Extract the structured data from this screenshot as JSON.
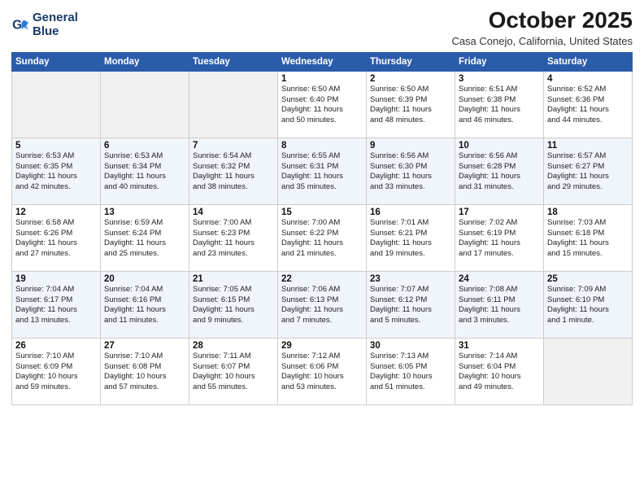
{
  "header": {
    "logo_line1": "General",
    "logo_line2": "Blue",
    "month": "October 2025",
    "location": "Casa Conejo, California, United States"
  },
  "weekdays": [
    "Sunday",
    "Monday",
    "Tuesday",
    "Wednesday",
    "Thursday",
    "Friday",
    "Saturday"
  ],
  "weeks": [
    [
      {
        "day": "",
        "info": ""
      },
      {
        "day": "",
        "info": ""
      },
      {
        "day": "",
        "info": ""
      },
      {
        "day": "1",
        "info": "Sunrise: 6:50 AM\nSunset: 6:40 PM\nDaylight: 11 hours\nand 50 minutes."
      },
      {
        "day": "2",
        "info": "Sunrise: 6:50 AM\nSunset: 6:39 PM\nDaylight: 11 hours\nand 48 minutes."
      },
      {
        "day": "3",
        "info": "Sunrise: 6:51 AM\nSunset: 6:38 PM\nDaylight: 11 hours\nand 46 minutes."
      },
      {
        "day": "4",
        "info": "Sunrise: 6:52 AM\nSunset: 6:36 PM\nDaylight: 11 hours\nand 44 minutes."
      }
    ],
    [
      {
        "day": "5",
        "info": "Sunrise: 6:53 AM\nSunset: 6:35 PM\nDaylight: 11 hours\nand 42 minutes."
      },
      {
        "day": "6",
        "info": "Sunrise: 6:53 AM\nSunset: 6:34 PM\nDaylight: 11 hours\nand 40 minutes."
      },
      {
        "day": "7",
        "info": "Sunrise: 6:54 AM\nSunset: 6:32 PM\nDaylight: 11 hours\nand 38 minutes."
      },
      {
        "day": "8",
        "info": "Sunrise: 6:55 AM\nSunset: 6:31 PM\nDaylight: 11 hours\nand 35 minutes."
      },
      {
        "day": "9",
        "info": "Sunrise: 6:56 AM\nSunset: 6:30 PM\nDaylight: 11 hours\nand 33 minutes."
      },
      {
        "day": "10",
        "info": "Sunrise: 6:56 AM\nSunset: 6:28 PM\nDaylight: 11 hours\nand 31 minutes."
      },
      {
        "day": "11",
        "info": "Sunrise: 6:57 AM\nSunset: 6:27 PM\nDaylight: 11 hours\nand 29 minutes."
      }
    ],
    [
      {
        "day": "12",
        "info": "Sunrise: 6:58 AM\nSunset: 6:26 PM\nDaylight: 11 hours\nand 27 minutes."
      },
      {
        "day": "13",
        "info": "Sunrise: 6:59 AM\nSunset: 6:24 PM\nDaylight: 11 hours\nand 25 minutes."
      },
      {
        "day": "14",
        "info": "Sunrise: 7:00 AM\nSunset: 6:23 PM\nDaylight: 11 hours\nand 23 minutes."
      },
      {
        "day": "15",
        "info": "Sunrise: 7:00 AM\nSunset: 6:22 PM\nDaylight: 11 hours\nand 21 minutes."
      },
      {
        "day": "16",
        "info": "Sunrise: 7:01 AM\nSunset: 6:21 PM\nDaylight: 11 hours\nand 19 minutes."
      },
      {
        "day": "17",
        "info": "Sunrise: 7:02 AM\nSunset: 6:19 PM\nDaylight: 11 hours\nand 17 minutes."
      },
      {
        "day": "18",
        "info": "Sunrise: 7:03 AM\nSunset: 6:18 PM\nDaylight: 11 hours\nand 15 minutes."
      }
    ],
    [
      {
        "day": "19",
        "info": "Sunrise: 7:04 AM\nSunset: 6:17 PM\nDaylight: 11 hours\nand 13 minutes."
      },
      {
        "day": "20",
        "info": "Sunrise: 7:04 AM\nSunset: 6:16 PM\nDaylight: 11 hours\nand 11 minutes."
      },
      {
        "day": "21",
        "info": "Sunrise: 7:05 AM\nSunset: 6:15 PM\nDaylight: 11 hours\nand 9 minutes."
      },
      {
        "day": "22",
        "info": "Sunrise: 7:06 AM\nSunset: 6:13 PM\nDaylight: 11 hours\nand 7 minutes."
      },
      {
        "day": "23",
        "info": "Sunrise: 7:07 AM\nSunset: 6:12 PM\nDaylight: 11 hours\nand 5 minutes."
      },
      {
        "day": "24",
        "info": "Sunrise: 7:08 AM\nSunset: 6:11 PM\nDaylight: 11 hours\nand 3 minutes."
      },
      {
        "day": "25",
        "info": "Sunrise: 7:09 AM\nSunset: 6:10 PM\nDaylight: 11 hours\nand 1 minute."
      }
    ],
    [
      {
        "day": "26",
        "info": "Sunrise: 7:10 AM\nSunset: 6:09 PM\nDaylight: 10 hours\nand 59 minutes."
      },
      {
        "day": "27",
        "info": "Sunrise: 7:10 AM\nSunset: 6:08 PM\nDaylight: 10 hours\nand 57 minutes."
      },
      {
        "day": "28",
        "info": "Sunrise: 7:11 AM\nSunset: 6:07 PM\nDaylight: 10 hours\nand 55 minutes."
      },
      {
        "day": "29",
        "info": "Sunrise: 7:12 AM\nSunset: 6:06 PM\nDaylight: 10 hours\nand 53 minutes."
      },
      {
        "day": "30",
        "info": "Sunrise: 7:13 AM\nSunset: 6:05 PM\nDaylight: 10 hours\nand 51 minutes."
      },
      {
        "day": "31",
        "info": "Sunrise: 7:14 AM\nSunset: 6:04 PM\nDaylight: 10 hours\nand 49 minutes."
      },
      {
        "day": "",
        "info": ""
      }
    ]
  ]
}
